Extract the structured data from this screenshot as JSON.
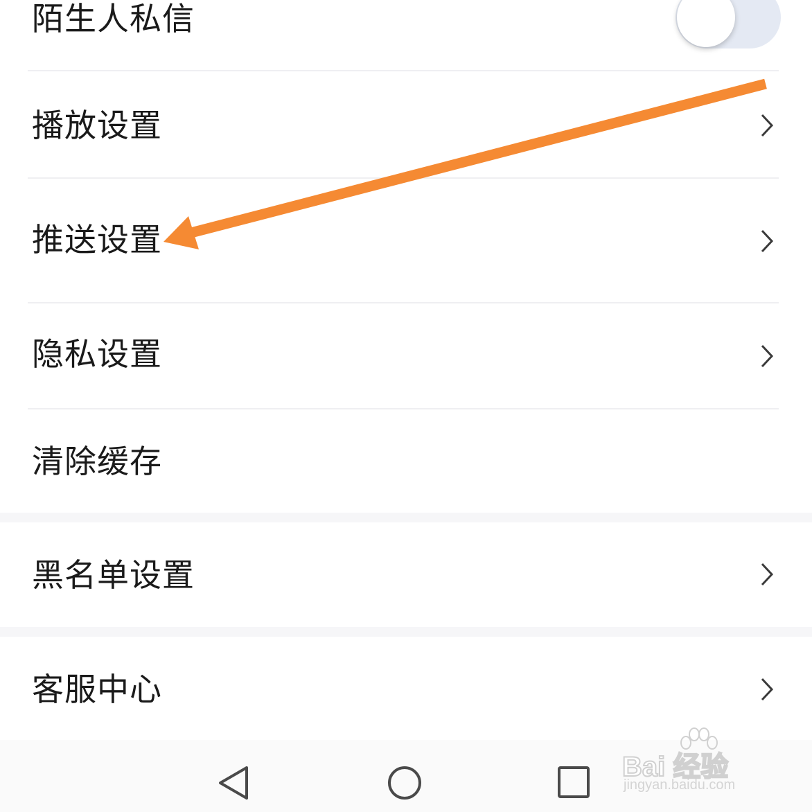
{
  "settings": {
    "items": [
      {
        "label": "陌生人私信"
      },
      {
        "label": "播放设置"
      },
      {
        "label": "推送设置"
      },
      {
        "label": "隐私设置"
      },
      {
        "label": "清除缓存"
      },
      {
        "label": "黑名单设置"
      },
      {
        "label": "客服中心"
      }
    ],
    "stranger_dm_enabled": false
  },
  "annotation": {
    "arrow_color": "#f58a33"
  },
  "navbar": {
    "back_icon": "triangle-back-icon",
    "home_icon": "circle-home-icon",
    "recents_icon": "square-recents-icon"
  },
  "watermark": {
    "brand": "Bai 经验",
    "url": "jingyan.baidu.com"
  },
  "colors": {
    "text": "#1a1a1a",
    "chevron": "#3a3a3a",
    "toggle_track": "#e4e9f3"
  }
}
